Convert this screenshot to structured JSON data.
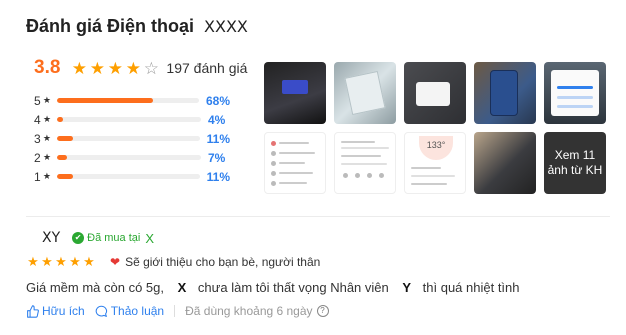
{
  "header": {
    "title": "Đánh giá Điện thoại",
    "product": "XXXX"
  },
  "summary": {
    "average": "3.8",
    "stars_filled": 4,
    "review_count": "197 đánh giá"
  },
  "distribution": [
    {
      "stars": "5",
      "percent": "68%",
      "fraction": 0.68
    },
    {
      "stars": "4",
      "percent": "4%",
      "fraction": 0.04
    },
    {
      "stars": "3",
      "percent": "11%",
      "fraction": 0.11
    },
    {
      "stars": "2",
      "percent": "7%",
      "fraction": 0.07
    },
    {
      "stars": "1",
      "percent": "11%",
      "fraction": 0.11
    }
  ],
  "gallery": {
    "more_label_line1": "Xem 11",
    "more_label_line2": "ảnh từ KH",
    "t8_value": "133°"
  },
  "review": {
    "author": "XY",
    "bought_label": "Đã mua tại",
    "bought_store": "X",
    "stars": 5,
    "recommend": "Sẽ giới thiệu cho bạn bè, người thân",
    "content_part1": "Giá mềm mà còn có 5g,",
    "content_mark1": "X",
    "content_part2": "chưa làm tôi thất vọng Nhân viên",
    "content_mark2": "Y",
    "content_part3": "thì quá nhiệt tình",
    "helpful": "Hữu ích",
    "discuss": "Thảo luận",
    "used": "Đã dùng khoảng 6 ngày",
    "help_icon": "?"
  },
  "colors": {
    "accent": "#fd6e1d",
    "star": "#fe9f00",
    "link": "#2f80ed",
    "bought": "#2ba832"
  }
}
